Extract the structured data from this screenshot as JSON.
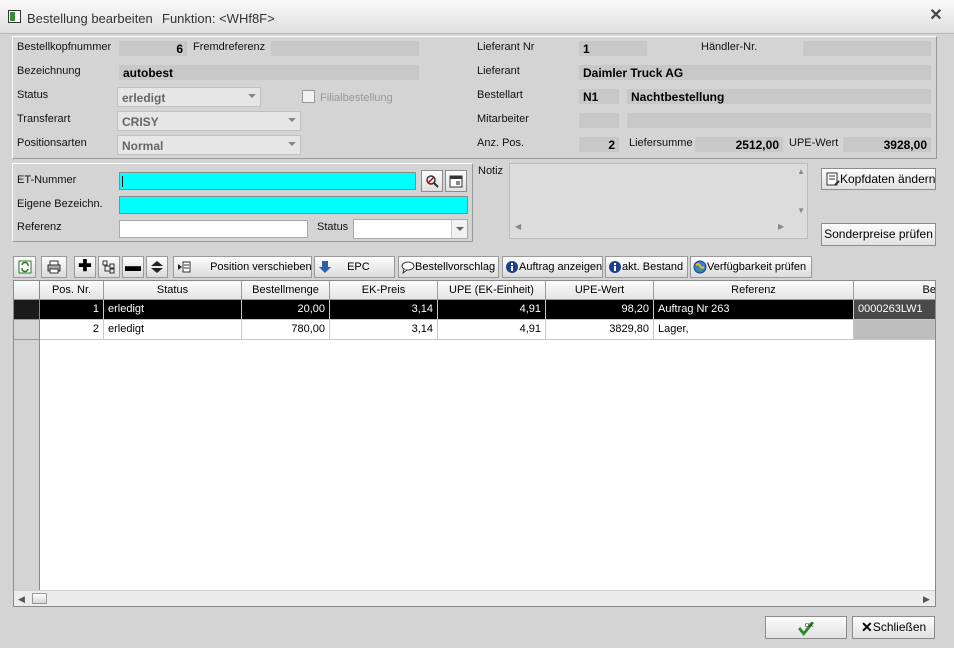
{
  "window": {
    "title": "Bestellung bearbeiten",
    "function": "Funktion: <WHf8F>"
  },
  "header": {
    "bestellkopfnummer_label": "Bestellkopfnummer",
    "bestellkopfnummer": "6",
    "fremdreferenz_label": "Fremdreferenz",
    "fremdreferenz": "",
    "bezeichnung_label": "Bezeichnung",
    "bezeichnung": "autobest",
    "status_label": "Status",
    "status": "erledigt",
    "filialbestellung_label": "Filialbestellung",
    "transferart_label": "Transferart",
    "transferart": "CRISY",
    "positionsarten_label": "Positionsarten",
    "positionsarten": "Normal",
    "lieferant_nr_label": "Lieferant Nr",
    "lieferant_nr": "1",
    "haendler_nr_label": "Händler-Nr.",
    "haendler_nr": "",
    "lieferant_label": "Lieferant",
    "lieferant": "Daimler Truck AG",
    "bestellart_label": "Bestellart",
    "bestellart_code": "N1",
    "bestellart": "Nachtbestellung",
    "mitarbeiter_label": "Mitarbeiter",
    "anz_pos_label": "Anz. Pos.",
    "anz_pos": "2",
    "liefersumme_label": "Liefersumme",
    "liefersumme": "2512,00",
    "upe_wert_label": "UPE-Wert",
    "upe_wert": "3928,00"
  },
  "filter": {
    "et_nummer_label": "ET-Nummer",
    "eigene_bezeichnung_label": "Eigene Bezeichn.",
    "referenz_label": "Referenz",
    "status_label": "Status",
    "notiz_label": "Notiz"
  },
  "side_buttons": {
    "kopfdaten": "Kopfdaten ändern",
    "sonderpreise": "Sonderpreise prüfen"
  },
  "toolbar": {
    "position_verschieben": "Position verschieben",
    "epc": "EPC",
    "bestellvorschlag": "Bestellvorschlag",
    "auftrag_anzeigen": "Auftrag anzeigen",
    "akt_bestand": "akt. Bestand",
    "verfuegbarkeit": "Verfügbarkeit prüfen"
  },
  "table": {
    "columns": [
      "Pos. Nr.",
      "Status",
      "Bestellmenge",
      "EK-Preis",
      "UPE (EK-Einheit)",
      "UPE-Wert",
      "Referenz",
      "Be"
    ],
    "rows": [
      {
        "pos": "1",
        "status": "erledigt",
        "menge": "20,00",
        "ek": "3,14",
        "upe": "4,91",
        "upe_wert": "98,20",
        "referenz": "Auftrag Nr 263",
        "be": "0000263LW1"
      },
      {
        "pos": "2",
        "status": "erledigt",
        "menge": "780,00",
        "ek": "3,14",
        "upe": "4,91",
        "upe_wert": "3829,80",
        "referenz": "Lager,",
        "be": ""
      }
    ]
  },
  "footer": {
    "ok_label": "OK",
    "schliessen": "Schließen"
  }
}
